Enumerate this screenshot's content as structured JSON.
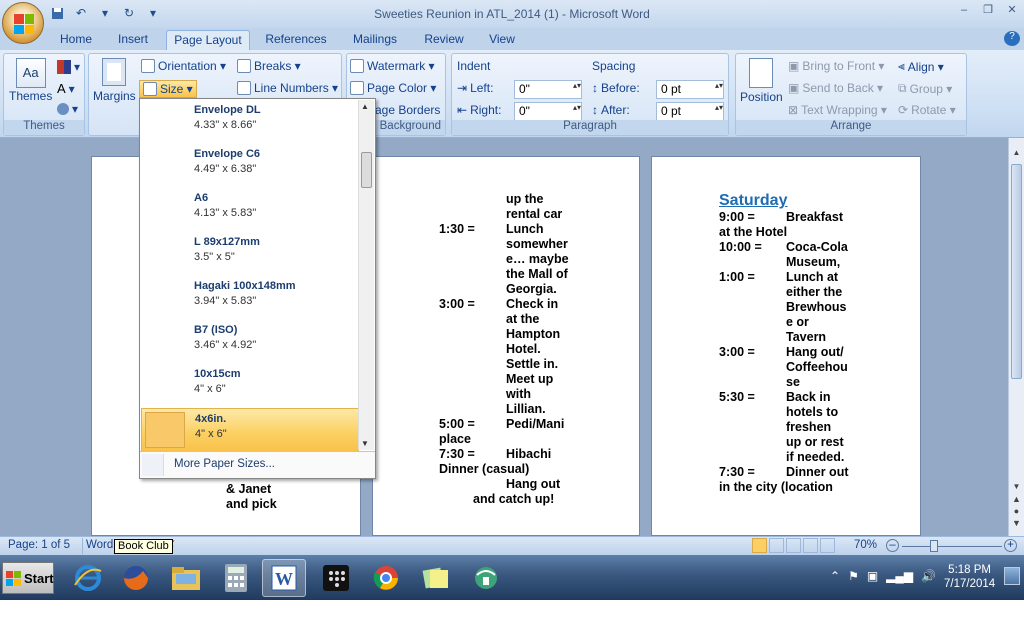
{
  "window": {
    "title": "Sweeties Reunion in ATL_2014 (1) - Microsoft Word",
    "minimize": "–",
    "restore": "❐",
    "close": "✕"
  },
  "qat": {
    "save_icon": "save-icon",
    "undo_label": "↶",
    "redo_label": "↻",
    "more_label": "▾"
  },
  "tabs": [
    "Home",
    "Insert",
    "Page Layout",
    "References",
    "Mailings",
    "Review",
    "View"
  ],
  "ribbon": {
    "themes": {
      "label": "Themes",
      "group": "Themes"
    },
    "page_setup": {
      "margins": "Margins",
      "orientation": "Orientation ▾",
      "size": "Size ▾",
      "breaks": "Breaks ▾",
      "line_numbers": "Line Numbers ▾"
    },
    "page_background": {
      "watermark": "Watermark ▾",
      "page_color": "Page Color ▾",
      "page_borders": "age Borders",
      "group": "Background"
    },
    "paragraph": {
      "indent": "Indent",
      "spacing": "Spacing",
      "left_label": "Left:",
      "left_value": "0\"",
      "right_label": "Right:",
      "right_value": "0\"",
      "before_label": "Before:",
      "before_value": "0 pt",
      "after_label": "After:",
      "after_value": "0 pt",
      "group": "Paragraph"
    },
    "arrange": {
      "position": "Position",
      "bring_to_front": "Bring to Front ▾",
      "send_to_back": "Send to Back ▾",
      "text_wrapping": "Text Wrapping ▾",
      "align": "Align ▾",
      "group_btn": "Group ▾",
      "rotate": "Rotate ▾",
      "group": "Arrange"
    }
  },
  "size_menu": {
    "items": [
      {
        "name": "Envelope DL",
        "dims": "4.33\" x 8.66\""
      },
      {
        "name": "Envelope C6",
        "dims": "4.49\" x 6.38\""
      },
      {
        "name": "A6",
        "dims": "4.13\" x 5.83\""
      },
      {
        "name": "L 89x127mm",
        "dims": "3.5\" x 5\""
      },
      {
        "name": "Hagaki 100x148mm",
        "dims": "3.94\" x 5.83\""
      },
      {
        "name": "B7 (ISO)",
        "dims": "3.46\" x 4.92\""
      },
      {
        "name": "10x15cm",
        "dims": "4\" x 6\""
      },
      {
        "name": "4x6in.",
        "dims": "4\" x 6\""
      }
    ],
    "more": "More Paper Sizes..."
  },
  "document": {
    "page1_lines": [
      "& Janet",
      "and pick"
    ],
    "page2": {
      "lines": [
        {
          "t": "",
          "d": "up the"
        },
        {
          "t": "",
          "d": "rental car"
        },
        {
          "t": "1:30 =",
          "d": "Lunch"
        },
        {
          "t": "",
          "d": "somewher"
        },
        {
          "t": "",
          "d": "e… maybe"
        },
        {
          "t": "",
          "d": "the Mall of"
        },
        {
          "t": "",
          "d": "Georgia."
        },
        {
          "t": "3:00 =",
          "d": "Check in"
        },
        {
          "t": "",
          "d": "at the"
        },
        {
          "t": "",
          "d": "Hampton"
        },
        {
          "t": "",
          "d": "Hotel."
        },
        {
          "t": "",
          "d": "Settle in."
        },
        {
          "t": "",
          "d": "Meet up"
        },
        {
          "t": "",
          "d": "with"
        },
        {
          "t": "",
          "d": "Lillian."
        },
        {
          "t": "5:00 =",
          "d": "Pedi/Mani"
        }
      ],
      "tail": [
        "place",
        "7:30 =         Hibachi",
        "Dinner (casual)",
        "Hang out",
        "and catch up!"
      ]
    },
    "page3": {
      "heading": "Saturday",
      "lines": [
        {
          "t": "9:00 =",
          "d": "Breakfast"
        },
        {
          "t": "at the Hotel",
          "d": ""
        },
        {
          "t": "10:00 =",
          "d": "Coca-Cola"
        },
        {
          "t": "",
          "d": "Museum,"
        },
        {
          "t": "1:00 =",
          "d": "Lunch at"
        },
        {
          "t": "",
          "d": "either the"
        },
        {
          "t": "",
          "d": "Brewhous"
        },
        {
          "t": "",
          "d": "e or"
        },
        {
          "t": "",
          "d": "Tavern"
        },
        {
          "t": "3:00 =",
          "d": "Hang out/"
        },
        {
          "t": "",
          "d": "Coffeehou"
        },
        {
          "t": "",
          "d": "se"
        },
        {
          "t": "5:30 =",
          "d": "Back in"
        },
        {
          "t": "",
          "d": "hotels to"
        },
        {
          "t": "",
          "d": "freshen"
        },
        {
          "t": "",
          "d": "up or rest"
        },
        {
          "t": "",
          "d": "if needed."
        },
        {
          "t": "7:30 =",
          "d": "Dinner out"
        },
        {
          "t": "in the city (location",
          "d": ""
        }
      ]
    }
  },
  "status": {
    "page": "Page: 1 of 5",
    "words": "Word",
    "zoom": "70%",
    "tooltip": "Book Club"
  },
  "taskbar": {
    "start": "Start",
    "time": "5:18 PM",
    "date": "7/17/2014"
  },
  "colors": {
    "accent": "#15428b",
    "heading": "#1f6cb0",
    "selected": "#fbcf61"
  }
}
